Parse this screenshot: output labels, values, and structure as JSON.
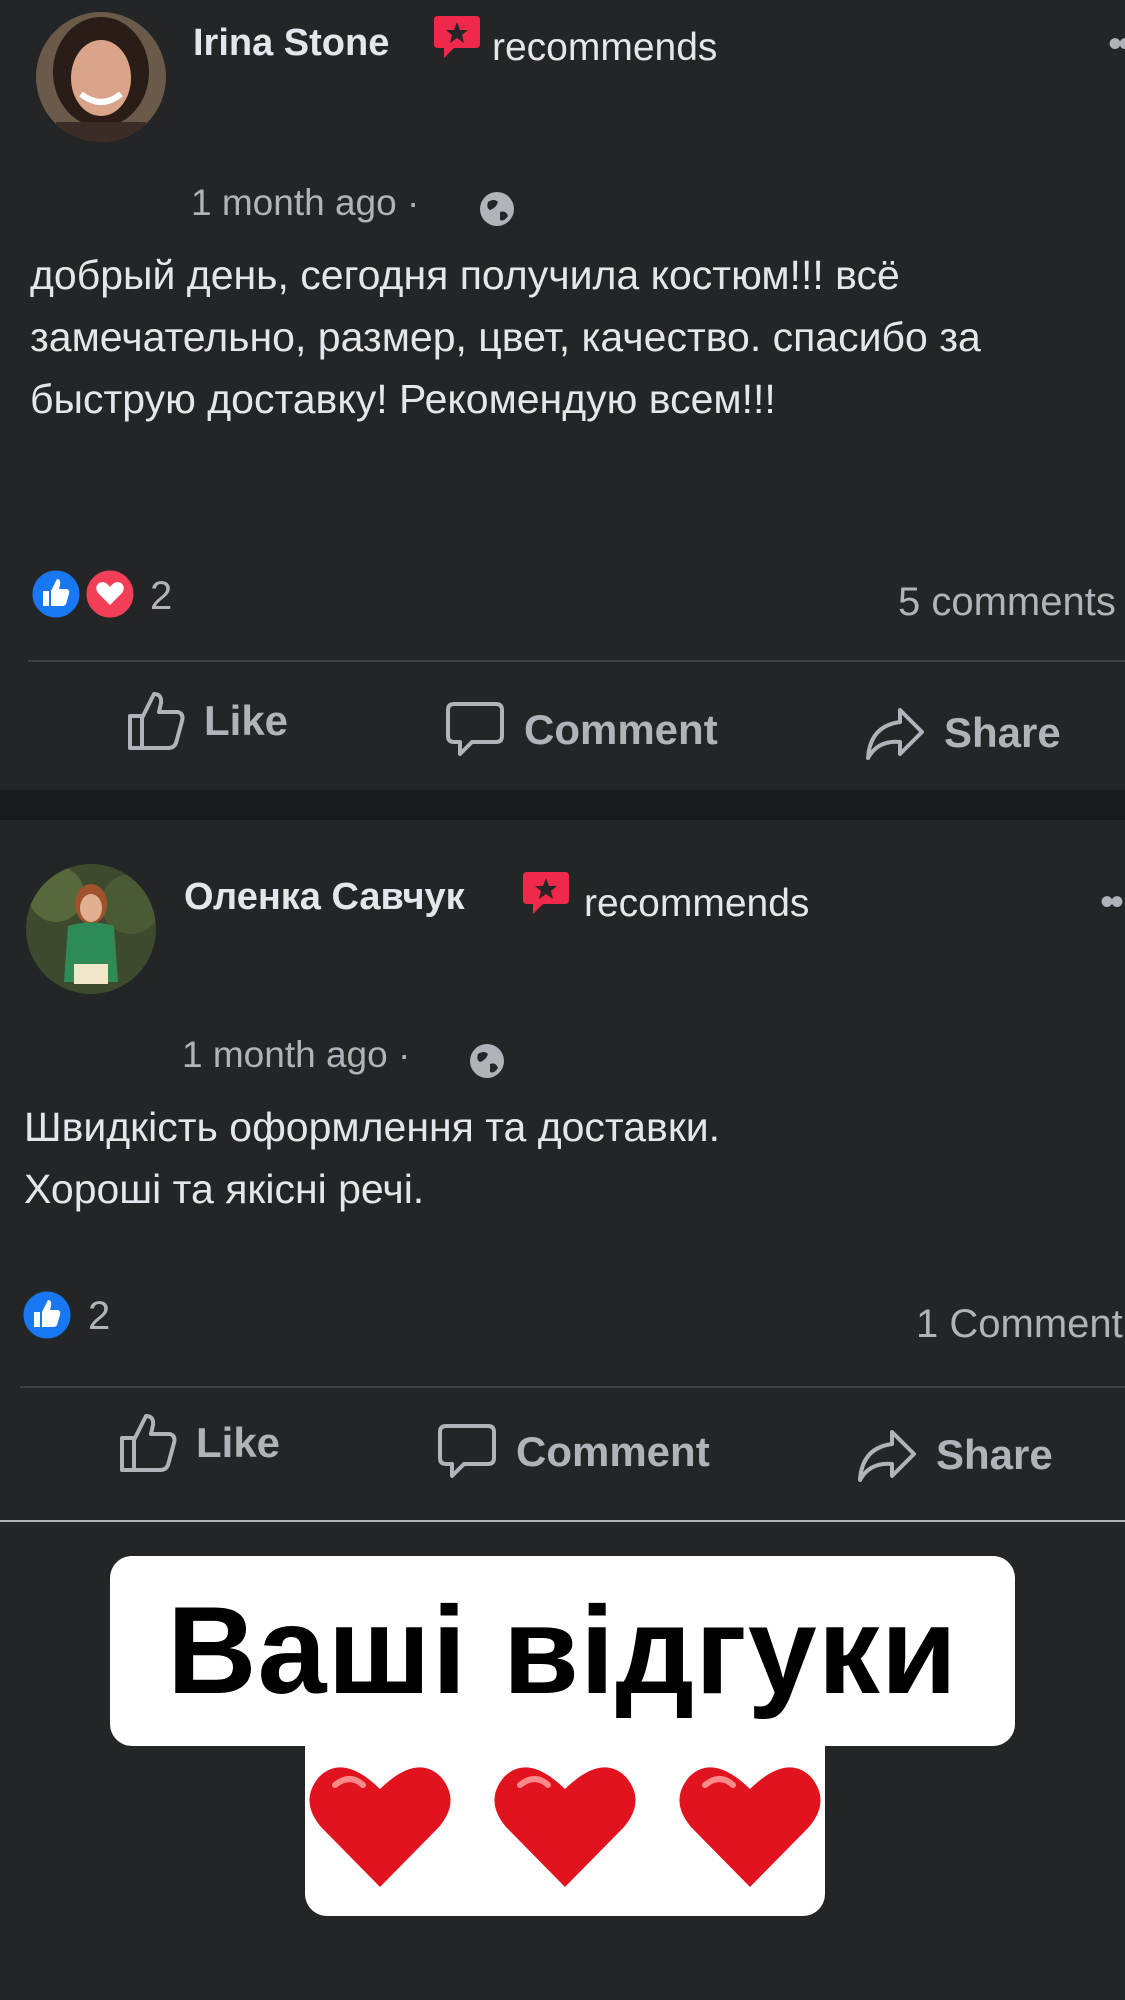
{
  "posts": [
    {
      "author": "Irina Stone",
      "recommends_label": "recommends",
      "time": "1 month ago ·",
      "text": "добрый день, сегодня получила костюм!!! всё замечательно, размер, цвет, качество. спасибо за быструю доставку! Рекомендую всем!!!",
      "reactions": [
        "like-icon",
        "love-icon"
      ],
      "reaction_count": "2",
      "comments": "5 comments",
      "actions": {
        "like": "Like",
        "comment": "Comment",
        "share": "Share"
      }
    },
    {
      "author": "Оленка Савчук",
      "recommends_label": "recommends",
      "time": "1 month ago ·",
      "text_line1": "Швидкість оформлення та доставки.",
      "text_line2": "Хороші та якісні речі.",
      "reactions": [
        "like-icon"
      ],
      "reaction_count": "2",
      "comments": "1 Comment",
      "actions": {
        "like": "Like",
        "comment": "Comment",
        "share": "Share"
      }
    }
  ],
  "banner": {
    "title": "Ваші відгуки",
    "hearts": "❤️❤️❤️"
  },
  "colors": {
    "background": "#242526",
    "separator": "#18191a",
    "text_primary": "#e4e6eb",
    "text_secondary": "#b0b3b8",
    "like_blue": "#1877f2",
    "love_red": "#f33e58",
    "recommend_red": "#f02849"
  }
}
